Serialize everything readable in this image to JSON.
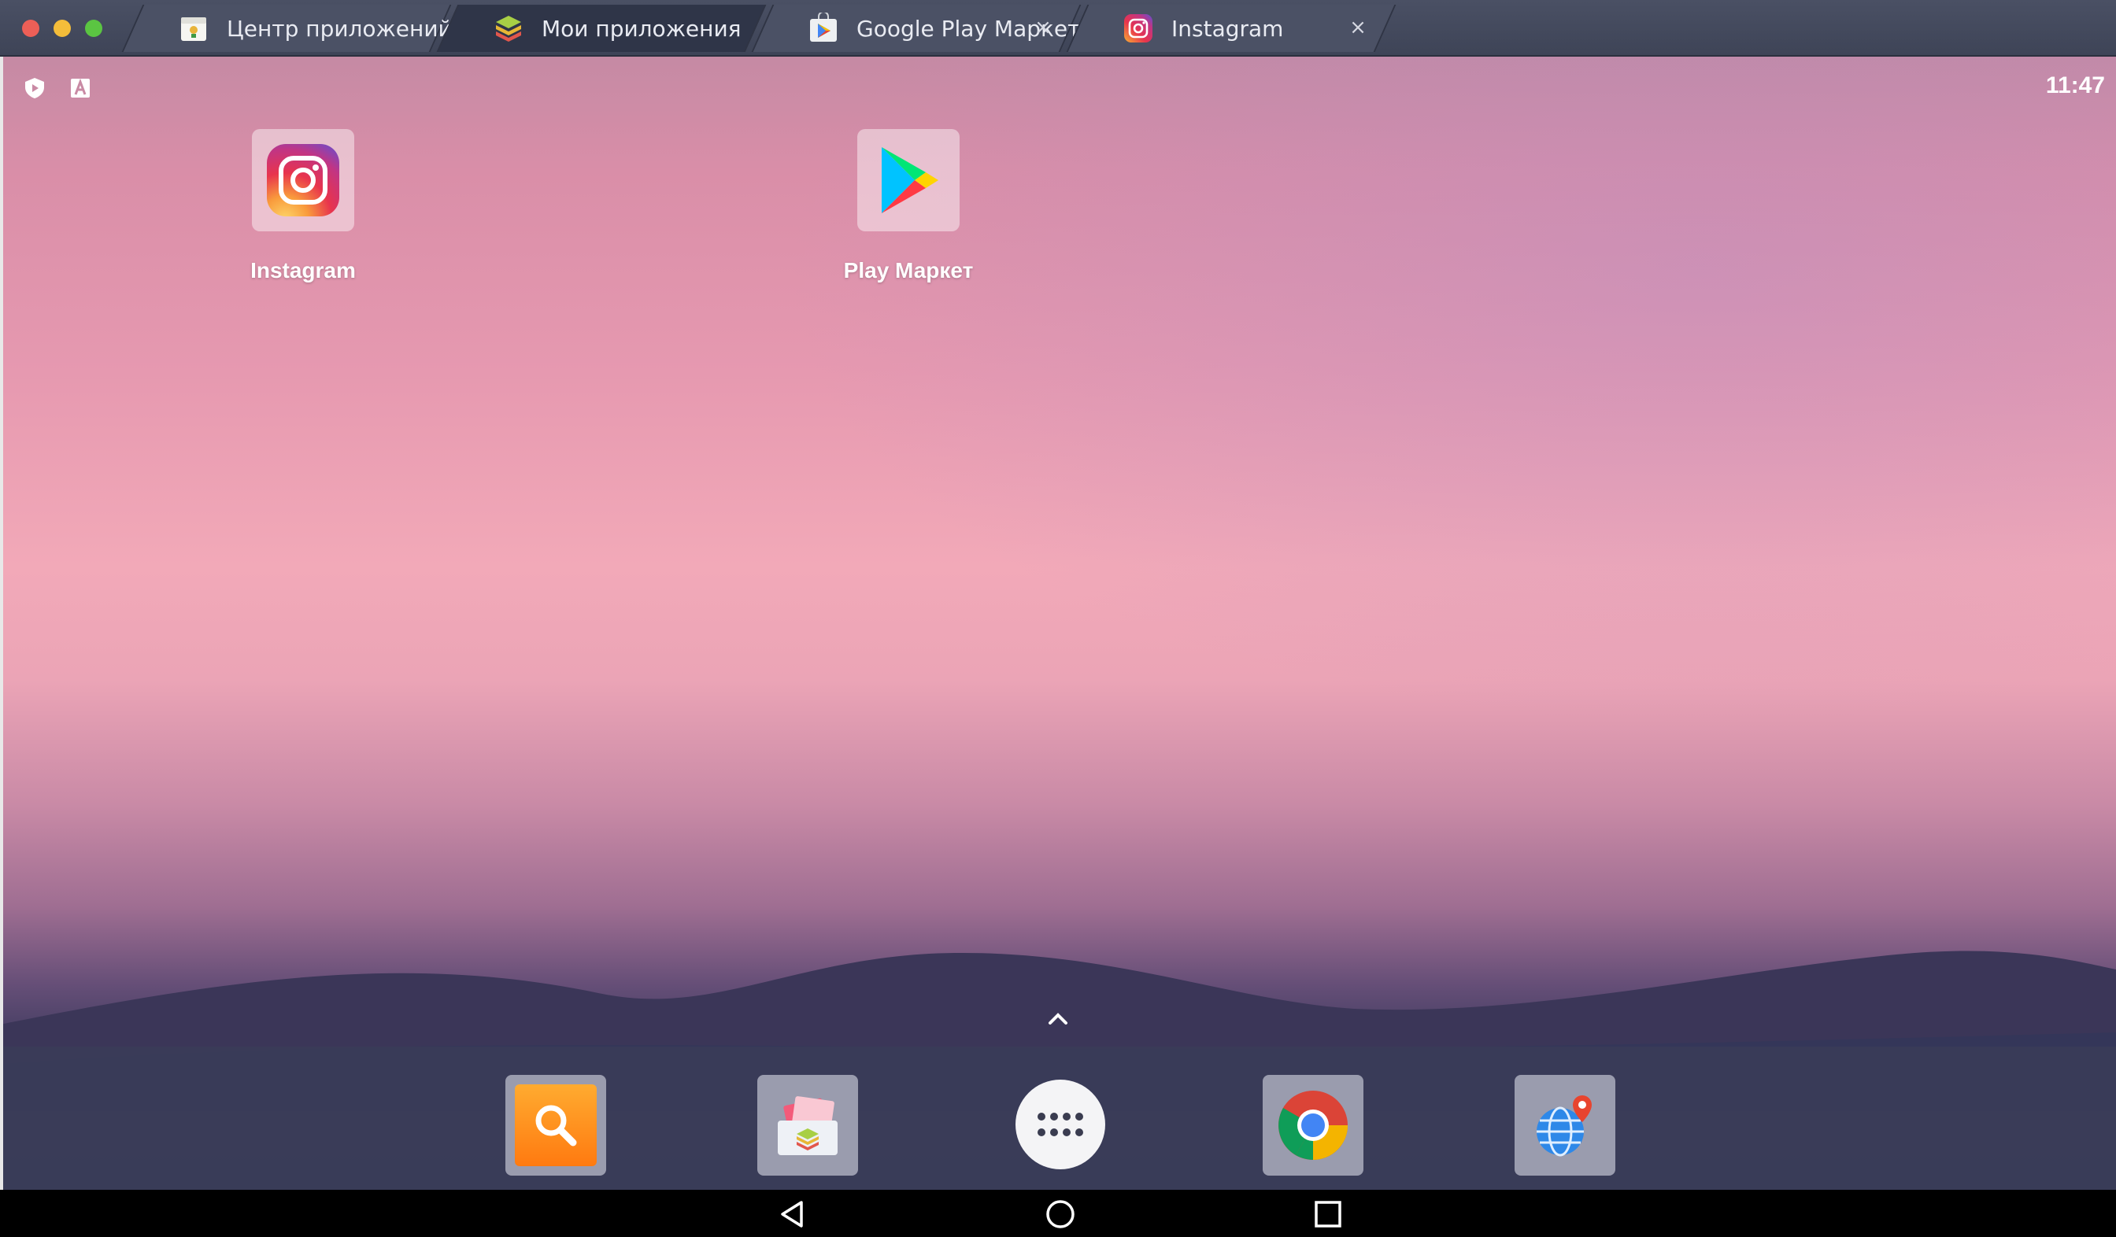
{
  "tabs": [
    {
      "label": "Центр приложений",
      "icon": "app-center-icon",
      "active": false,
      "closable": false
    },
    {
      "label": "Мои приложения",
      "icon": "my-apps-icon",
      "active": true,
      "closable": false
    },
    {
      "label": "Google Play Маркет",
      "icon": "google-play-icon",
      "active": false,
      "closable": true
    },
    {
      "label": "Instagram",
      "icon": "instagram-icon",
      "active": false,
      "closable": true
    }
  ],
  "tab_close_glyph": "×",
  "status_bar": {
    "time": "11:47",
    "icons": [
      "shield-icon",
      "keyboard-a-icon"
    ]
  },
  "desktop_apps": [
    {
      "label": "Instagram",
      "icon": "instagram-icon"
    },
    {
      "label": "Play Маркет",
      "icon": "google-play-icon"
    }
  ],
  "dock": {
    "items": [
      "search-app-icon",
      "app-installer-icon",
      "app-drawer-icon",
      "chrome-icon",
      "browser-globe-icon"
    ]
  },
  "navigation": [
    "back-icon",
    "home-icon",
    "recents-icon"
  ],
  "colors": {
    "titlebar": "#444a5e",
    "active_tab": "#2f3548",
    "dock": "#3a3c58",
    "navbar": "#000000",
    "status_text": "#ffffff"
  }
}
